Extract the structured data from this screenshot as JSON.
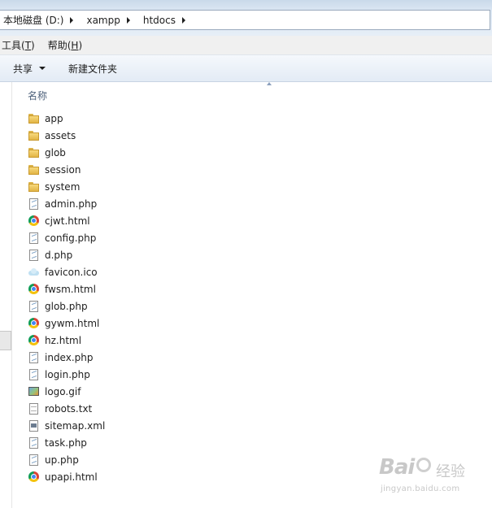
{
  "breadcrumb": [
    "本地磁盘 (D:)",
    "xampp",
    "htdocs"
  ],
  "menu": [
    {
      "label": "工具(T)",
      "pre": "工具(",
      "key": "T",
      "post": ")"
    },
    {
      "label": "帮助(H)",
      "pre": "帮助(",
      "key": "H",
      "post": ")"
    }
  ],
  "toolbar": {
    "share_label": "共享",
    "new_folder_label": "新建文件夹"
  },
  "list": {
    "column_header": "名称",
    "items": [
      {
        "name": "app",
        "icon": "folder-icon",
        "type": "folder"
      },
      {
        "name": "assets",
        "icon": "folder-icon",
        "type": "folder"
      },
      {
        "name": "glob",
        "icon": "folder-icon",
        "type": "folder"
      },
      {
        "name": "session",
        "icon": "folder-icon",
        "type": "folder"
      },
      {
        "name": "system",
        "icon": "folder-icon",
        "type": "folder"
      },
      {
        "name": "admin.php",
        "icon": "php-file-icon",
        "type": "php"
      },
      {
        "name": "cjwt.html",
        "icon": "chrome-html-icon",
        "type": "html"
      },
      {
        "name": "config.php",
        "icon": "php-file-icon",
        "type": "php"
      },
      {
        "name": "d.php",
        "icon": "php-file-icon",
        "type": "php"
      },
      {
        "name": "favicon.ico",
        "icon": "ico-file-icon",
        "type": "ico"
      },
      {
        "name": "fwsm.html",
        "icon": "chrome-html-icon",
        "type": "html"
      },
      {
        "name": "glob.php",
        "icon": "php-file-icon",
        "type": "php"
      },
      {
        "name": "gywm.html",
        "icon": "chrome-html-icon",
        "type": "html"
      },
      {
        "name": "hz.html",
        "icon": "chrome-html-icon",
        "type": "html"
      },
      {
        "name": "index.php",
        "icon": "php-file-icon",
        "type": "php"
      },
      {
        "name": "login.php",
        "icon": "php-file-icon",
        "type": "php"
      },
      {
        "name": "logo.gif",
        "icon": "gif-image-icon",
        "type": "gif"
      },
      {
        "name": "robots.txt",
        "icon": "text-file-icon",
        "type": "txt"
      },
      {
        "name": "sitemap.xml",
        "icon": "xml-file-icon",
        "type": "xml"
      },
      {
        "name": "task.php",
        "icon": "php-file-icon",
        "type": "php"
      },
      {
        "name": "up.php",
        "icon": "php-file-icon",
        "type": "php"
      },
      {
        "name": "upapi.html",
        "icon": "chrome-html-icon",
        "type": "html"
      }
    ]
  },
  "watermark": {
    "brand": "Bai",
    "cn": "经验",
    "url": "jingyan.baidu.com"
  }
}
